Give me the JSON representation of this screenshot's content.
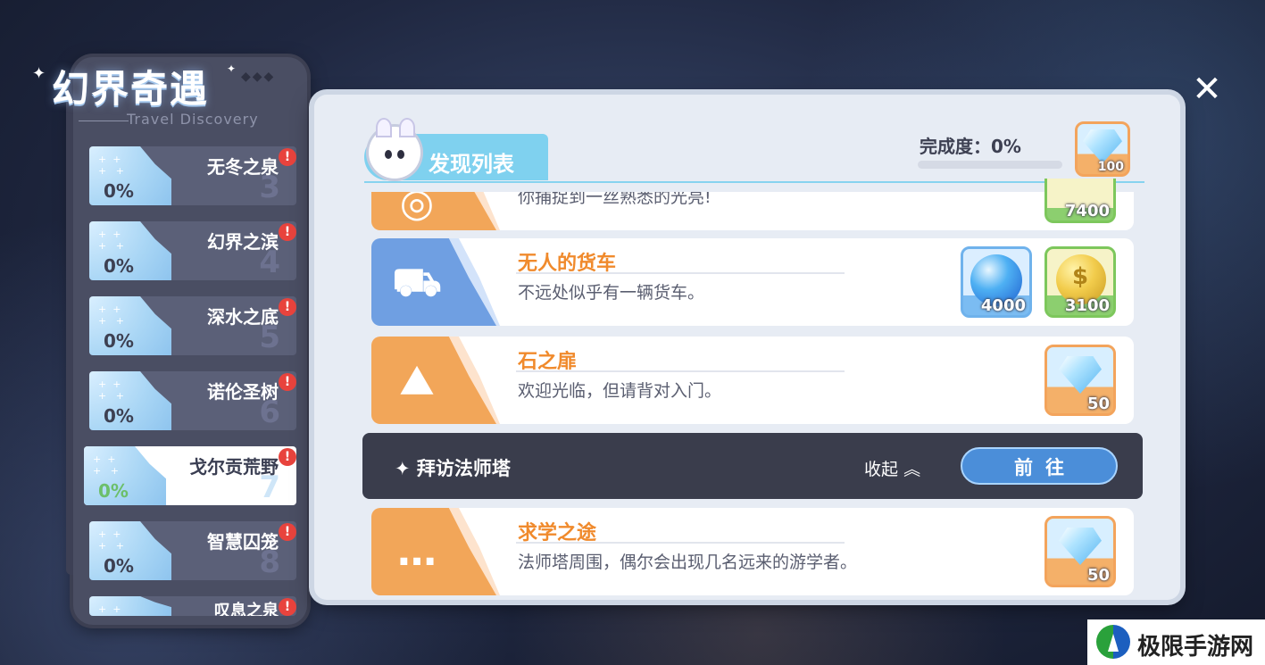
{
  "title": {
    "cn": "幻界奇遇",
    "en": "Travel Discovery"
  },
  "areas": [
    {
      "name": "无冬之泉",
      "number": "3",
      "percent": "0%",
      "alert": "!",
      "active": false
    },
    {
      "name": "幻界之滨",
      "number": "4",
      "percent": "0%",
      "alert": "!",
      "active": false
    },
    {
      "name": "深水之底",
      "number": "5",
      "percent": "0%",
      "alert": "!",
      "active": false
    },
    {
      "name": "诺伦圣树",
      "number": "6",
      "percent": "0%",
      "alert": "!",
      "active": false
    },
    {
      "name": "戈尔贡荒野",
      "number": "7",
      "percent": "0%",
      "alert": "!",
      "active": true
    },
    {
      "name": "智慧囚笼",
      "number": "8",
      "percent": "0%",
      "alert": "!",
      "active": false
    },
    {
      "name": "叹息之泉",
      "number": "",
      "percent": "",
      "alert": "!",
      "active": false
    }
  ],
  "header": {
    "title": "发现列表",
    "progress_label": "完成度：0%",
    "progress_value": 0,
    "reward": {
      "icon": "diamond-icon",
      "amount": "100"
    }
  },
  "discoveries": [
    {
      "title": "",
      "desc": "你捕捉到一丝熟悉的光亮!",
      "icon": "target-icon",
      "rewards": [
        {
          "icon": "gold-coin-icon",
          "amount": "7400"
        }
      ]
    },
    {
      "title": "无人的货车",
      "desc": "不远处似乎有一辆货车。",
      "icon": "wagon-icon",
      "rewards": [
        {
          "icon": "blue-orb-icon",
          "amount": "4000"
        },
        {
          "icon": "gold-coin-icon",
          "amount": "3100"
        }
      ]
    },
    {
      "title": "石之扉",
      "desc": "欢迎光临，但请背对入门。",
      "icon": "mountain-path-icon",
      "rewards": [
        {
          "icon": "diamond-icon",
          "amount": "50"
        }
      ]
    },
    {
      "title": "求学之途",
      "desc": "法师塔周围，偶尔会出现几名远来的游学者。",
      "icon": "chat-bubble-icon",
      "rewards": [
        {
          "icon": "diamond-icon",
          "amount": "50"
        }
      ]
    }
  ],
  "section": {
    "title": "拜访法师塔",
    "collapse_label": "收起",
    "goto_label": "前往"
  },
  "watermark": {
    "text": "极限手游网"
  },
  "colors": {
    "accent_blue": "#7fd1ef",
    "title_orange": "#f08a2c",
    "alert_red": "#e8433d",
    "button_blue": "#4b8ed9"
  }
}
